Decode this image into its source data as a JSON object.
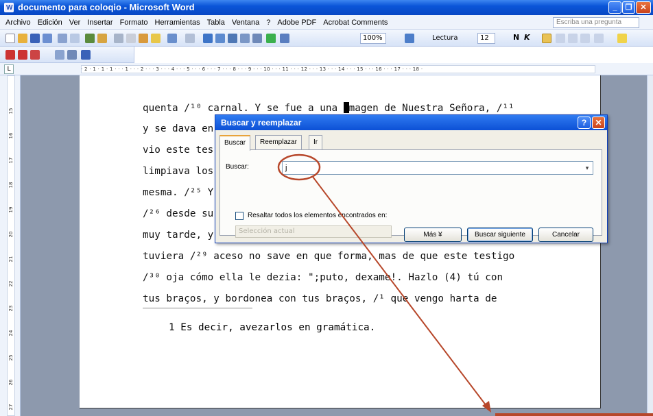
{
  "window": {
    "title": "documento para coloqio - Microsoft Word"
  },
  "menu": {
    "items": [
      "Archivo",
      "Edición",
      "Ver",
      "Insertar",
      "Formato",
      "Herramientas",
      "Tabla",
      "Ventana",
      "?",
      "Adobe PDF",
      "Acrobat Comments"
    ],
    "ask_placeholder": "Escriba una pregunta"
  },
  "toolbar": {
    "zoom": "100%",
    "lectura_label": "Lectura",
    "font_size": "12",
    "bold": "N",
    "italic": "K"
  },
  "ruler": {
    "horizontal": "· 2 · 1 · 1 · 1 · · · 1 · · · 2 · · · 3 · · · 4 · · · 5 · · · 6 · · · 7 · · · 8 · · · 9 · · · 10 · · · 11 · · · 12 · · · 13 · · · 14 · · · 15 · · · 16 · · · 17 · · · 18 ·",
    "vertical": [
      "15",
      "16",
      "17",
      "18",
      "19",
      "20",
      "21",
      "22",
      "23",
      "24",
      "25",
      "26",
      "27"
    ]
  },
  "document": {
    "lines": [
      "quenta /¹⁰ carnal. Y se fue a una ",
      "y se dava en",
      "vio este tes",
      "limpiava los",
      "mesma. /²⁵ Y",
      "/²⁶ desde su",
      "muy tarde, y",
      "tuviera /²⁹ aceso no save en que forma, mas de que este testigo",
      "/³⁰ oja cómo ella le dezia: \";puto, dexame!. Hazlo (4) tú con",
      "tus braços, y bordonea con tus braços, /¹ que vengo harta de"
    ],
    "line0_tail": "magen de Nuestra Señora, /¹¹",
    "footnote": "1 Es decir, avezarlos en gramática."
  },
  "dialog": {
    "title": "Buscar y reemplazar",
    "tabs": [
      "Buscar",
      "Reemplazar",
      "Ir a"
    ],
    "find_label": "Buscar:",
    "find_value": "j",
    "highlight_label": "Resaltar todos los elementos encontrados en:",
    "scope_value": "Selección actual",
    "more_button": "Más ¥",
    "find_next_button": "Buscar siguiente",
    "cancel_button": "Cancelar"
  },
  "colors": {
    "annotation": "#b7472a"
  }
}
